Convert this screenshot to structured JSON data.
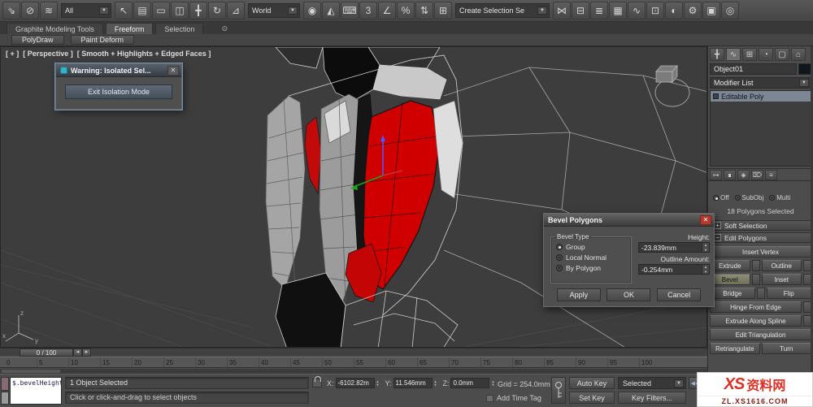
{
  "ui_glyphs": {
    "chevron": "▼",
    "spinner_up": "▲",
    "spinner_down": "▼",
    "slider_left": "◂",
    "slider_right": "▸",
    "minimize": "⊙",
    "close": "✕",
    "rollout_open": "−",
    "rollout_closed": "+"
  },
  "toolbar": {
    "items": [
      {
        "name": "select-and-link-icon",
        "glyph": "⇘"
      },
      {
        "name": "unlink-selection-icon",
        "glyph": "⊘"
      },
      {
        "name": "bind-to-space-warp-icon",
        "glyph": "≋"
      },
      {
        "kind": "dropdown",
        "name": "selection-filter-dropdown",
        "label": "All"
      },
      {
        "name": "select-object-icon",
        "glyph": "↖"
      },
      {
        "name": "select-by-name-icon",
        "glyph": "▤"
      },
      {
        "name": "selection-region-icon",
        "glyph": "▭"
      },
      {
        "name": "window-crossing-icon",
        "glyph": "◫"
      },
      {
        "name": "select-and-move-icon",
        "glyph": "╋"
      },
      {
        "name": "select-and-rotate-icon",
        "glyph": "↻"
      },
      {
        "name": "select-and-scale-icon",
        "glyph": "⊿"
      },
      {
        "kind": "dropdown",
        "name": "reference-coordinate-dropdown",
        "label": "World"
      },
      {
        "name": "use-pivot-center-icon",
        "glyph": "◉"
      },
      {
        "name": "select-and-manipulate-icon",
        "glyph": "◭"
      },
      {
        "name": "keyboard-override-icon",
        "glyph": "⌨"
      },
      {
        "name": "snaps-toggle-icon",
        "glyph": "3"
      },
      {
        "name": "angle-snap-icon",
        "glyph": "∠"
      },
      {
        "name": "percent-snap-icon",
        "glyph": "%"
      },
      {
        "name": "spinner-snap-icon",
        "glyph": "⇅"
      },
      {
        "name": "edit-named-selection-sets-icon",
        "glyph": "⊞"
      },
      {
        "kind": "dropdown",
        "name": "named-selection-sets-dropdown",
        "label": "Create Selection Se"
      },
      {
        "name": "mirror-icon",
        "glyph": "⋈"
      },
      {
        "name": "align-icon",
        "glyph": "⊟"
      },
      {
        "name": "layer-manager-icon",
        "glyph": "≣"
      },
      {
        "name": "graphite-toggle-icon",
        "glyph": "▦"
      },
      {
        "name": "curve-editor-icon",
        "glyph": "∿"
      },
      {
        "name": "schematic-view-icon",
        "glyph": "⊡"
      },
      {
        "name": "material-editor-icon",
        "glyph": "◐"
      },
      {
        "name": "render-setup-icon",
        "glyph": "⚙"
      },
      {
        "name": "rendered-frame-icon",
        "glyph": "▣"
      },
      {
        "name": "render-production-icon",
        "glyph": "◎"
      }
    ]
  },
  "ribbon": {
    "tabs": [
      "Graphite Modeling Tools",
      "Freeform",
      "Selection"
    ],
    "active_tab": "Freeform",
    "panels": [
      "PolyDraw",
      "Paint Deform"
    ]
  },
  "viewport": {
    "menu_plus": "[ + ]",
    "menu_view": "[ Perspective ]",
    "menu_shading": "[ Smooth + Highlights + Edged Faces ]"
  },
  "warning_dialog": {
    "title": "Warning: Isolated Sel...",
    "button": "Exit Isolation Mode"
  },
  "bevel_dialog": {
    "title": "Bevel Polygons",
    "group_label": "Bevel Type",
    "options": [
      "Group",
      "Local Normal",
      "By Polygon"
    ],
    "selected_option": "Group",
    "height_label": "Height:",
    "height_value": "-23.839mm",
    "outline_label": "Outline Amount:",
    "outline_value": "-0.254mm",
    "apply": "Apply",
    "ok": "OK",
    "cancel": "Cancel"
  },
  "command_panel": {
    "tabs": [
      {
        "name": "create-tab-icon",
        "glyph": "╋"
      },
      {
        "name": "modify-tab-icon",
        "glyph": "∿",
        "active": true
      },
      {
        "name": "hierarchy-tab-icon",
        "glyph": "⊞"
      },
      {
        "name": "motion-tab-icon",
        "glyph": "◔"
      },
      {
        "name": "display-tab-icon",
        "glyph": "▢"
      },
      {
        "name": "utilities-tab-icon",
        "glyph": "⌂"
      }
    ],
    "object_name": "Object01",
    "modifier_list_label": "Modifier List",
    "stack_item": "Editable Poly",
    "stack_tools": [
      {
        "name": "pin-stack-icon",
        "glyph": "⊶"
      },
      {
        "name": "show-end-result-icon",
        "glyph": "∎"
      },
      {
        "name": "make-unique-icon",
        "glyph": "◈"
      },
      {
        "name": "remove-modifier-icon",
        "glyph": "⌦"
      },
      {
        "name": "configure-modifier-sets-icon",
        "glyph": "≡"
      }
    ],
    "preview_selection": {
      "options": [
        "Off",
        "SubObj",
        "Multi"
      ],
      "selected": "Off"
    },
    "selection_status": "18 Polygons Selected",
    "rollouts": {
      "soft_selection": "Soft Selection",
      "edit_polygons": "Edit Polygons"
    },
    "action_rows": [
      {
        "cells": [
          {
            "label": "Insert Vertex"
          }
        ]
      },
      {
        "cells": [
          {
            "label": "Extrude",
            "box": true
          },
          {
            "label": "Outline",
            "box": true
          }
        ]
      },
      {
        "cells": [
          {
            "label": "Bevel",
            "box": true,
            "active": true
          },
          {
            "label": "Inset",
            "box": true
          }
        ]
      },
      {
        "cells": [
          {
            "label": "Bridge",
            "box": true
          },
          {
            "label": "Flip"
          }
        ]
      },
      {
        "cells": [
          {
            "label": "Hinge From Edge",
            "box": true
          }
        ]
      },
      {
        "cells": [
          {
            "label": "Extrude Along Spline",
            "box": true
          }
        ]
      },
      {
        "cells": [
          {
            "label": "Edit Triangulation"
          }
        ]
      },
      {
        "cells": [
          {
            "label": "Retriangulate"
          },
          {
            "label": "Turn"
          }
        ]
      }
    ]
  },
  "timeline": {
    "slider_label": "0 / 100",
    "ticks": [
      "0",
      "5",
      "10",
      "15",
      "20",
      "25",
      "30",
      "35",
      "40",
      "45",
      "50",
      "55",
      "60",
      "65",
      "70",
      "75",
      "80",
      "85",
      "90",
      "95",
      "100"
    ]
  },
  "status_bar": {
    "listener_text": "$.bevelHeight",
    "selection_text": "1 Object Selected",
    "coords": [
      {
        "label": "X:",
        "value": "-6102.82m"
      },
      {
        "label": "Y:",
        "value": "11.546mm"
      },
      {
        "label": "Z:",
        "value": "0.0mm"
      }
    ],
    "grid_text": "Grid = 254.0mm",
    "prompt": "Click or click-and-drag to select objects",
    "add_time_tag": "Add Time Tag",
    "auto_key": "Auto Key",
    "set_key": "Set Key",
    "selected_set": "Selected",
    "key_filters": "Key Filters...",
    "playback": [
      {
        "name": "go-to-start-button",
        "glyph": "◀◀"
      },
      {
        "name": "previous-frame-button",
        "glyph": "◀"
      },
      {
        "name": "play-button",
        "glyph": "▶"
      },
      {
        "name": "go-to-end-button",
        "glyph": "▶▶"
      }
    ]
  },
  "watermark": {
    "logo": "XS",
    "line1": "资料网",
    "line2": "ZL.XS1616.COM"
  }
}
